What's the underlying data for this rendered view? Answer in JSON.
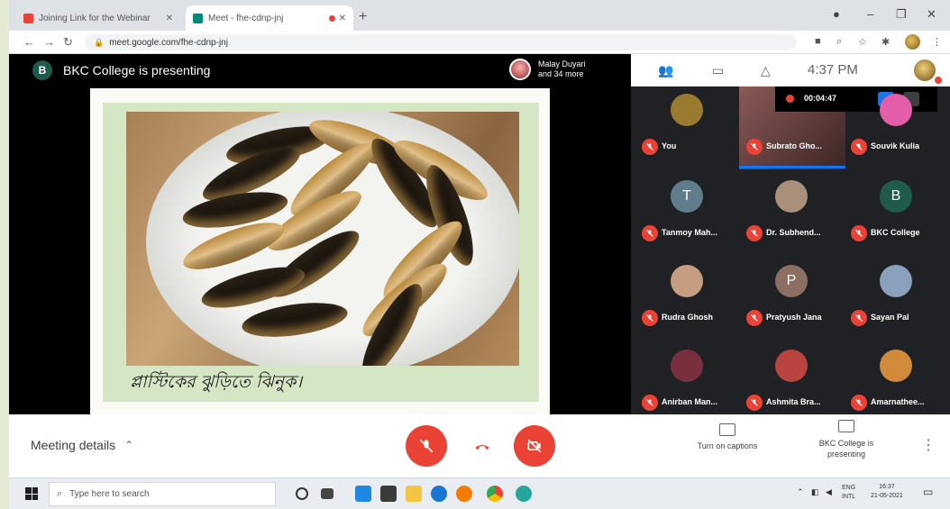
{
  "browser": {
    "tabs": [
      {
        "title": "Joining Link for the Webinar",
        "active": false
      },
      {
        "title": "Meet - fhe-cdnp-jnj",
        "active": true
      }
    ],
    "url": "meet.google.com/fhe-cdnp-jnj"
  },
  "meet": {
    "presenting_avatar": "B",
    "presenting_text": "BKC College is presenting",
    "presenter_chip_name": "Malay Duyari",
    "presenter_chip_more": "and 34 more",
    "clock": "4:37 PM",
    "recording_time": "00:04:47",
    "slide_caption": "প্লাস্টিকের ঝুড়িতে ঝিনুক।",
    "participants": [
      {
        "name": "You",
        "initial": "",
        "color": "#9a7a2e"
      },
      {
        "name": "Subrato Gho...",
        "initial": "",
        "color": "#6b3b3a"
      },
      {
        "name": "Souvik Kulia",
        "initial": "",
        "color": "#e35da8"
      },
      {
        "name": "Tanmoy Mah...",
        "initial": "T",
        "color": "#607d8b"
      },
      {
        "name": "Dr. Subhend...",
        "initial": "",
        "color": "#a9907a"
      },
      {
        "name": "BKC College",
        "initial": "B",
        "color": "#1e5b4a"
      },
      {
        "name": "Rudra Ghosh",
        "initial": "",
        "color": "#c79d82"
      },
      {
        "name": "Pratyush Jana",
        "initial": "P",
        "color": "#8d6e63"
      },
      {
        "name": "Sayan Pal",
        "initial": "",
        "color": "#8aa0bc"
      },
      {
        "name": "Anirban Man...",
        "initial": "",
        "color": "#7a2f3f"
      },
      {
        "name": "Ashmita Bra...",
        "initial": "",
        "color": "#b8433f"
      },
      {
        "name": "Amarnathee...",
        "initial": "",
        "color": "#d08a3a"
      }
    ],
    "meeting_details": "Meeting details",
    "captions_label": "Turn on captions",
    "present_label": "BKC College is presenting"
  },
  "taskbar": {
    "search_placeholder": "Type here to search",
    "lang": "ENG",
    "region": "INTL",
    "time": "16:37",
    "date": "21-05-2021"
  }
}
